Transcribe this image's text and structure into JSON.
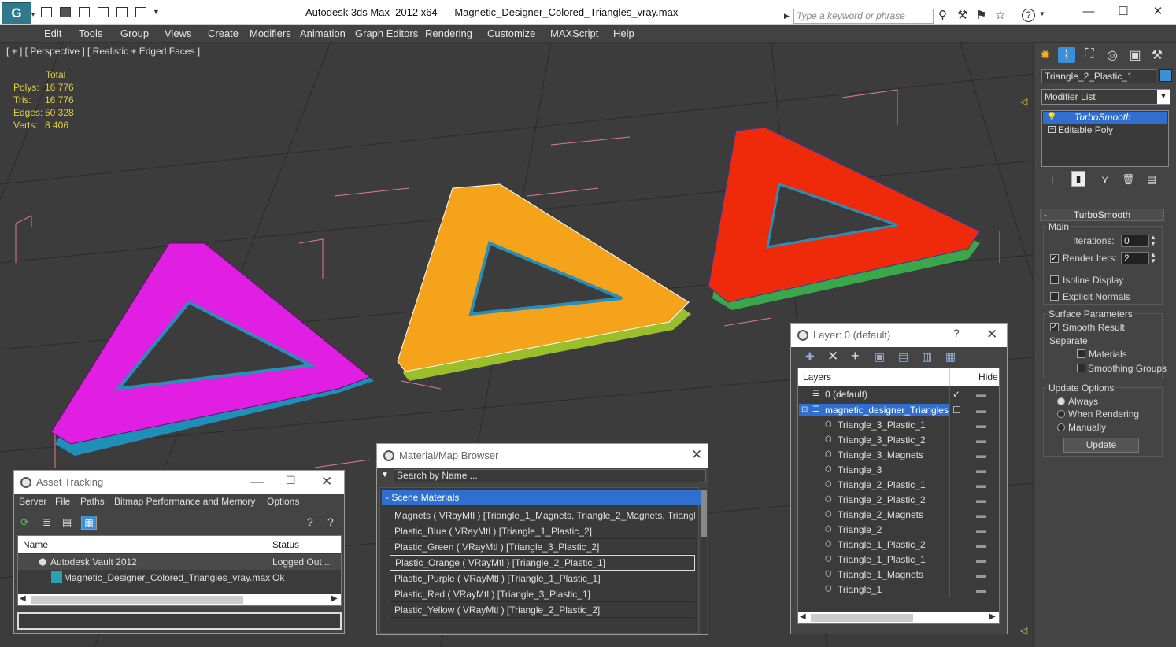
{
  "app": {
    "title": "Autodesk 3ds Max  2012 x64",
    "file": "Magnetic_Designer_Colored_Triangles_vray.max",
    "search_placeholder": "Type a keyword or phrase",
    "logo": "G"
  },
  "menu": [
    "Edit",
    "Tools",
    "Group",
    "Views",
    "Create",
    "Modifiers",
    "Animation",
    "Graph Editors",
    "Rendering",
    "Customize",
    "MAXScript",
    "Help"
  ],
  "viewport": {
    "label": "[ + ] [ Perspective ] [ Realistic + Edged Faces ]",
    "stats": {
      "header": "Total",
      "rows": [
        {
          "k": "Polys:",
          "v": "16 776"
        },
        {
          "k": "Tris:",
          "v": "16 776"
        },
        {
          "k": "Edges:",
          "v": "50 328"
        },
        {
          "k": "Verts:",
          "v": "8 406"
        }
      ]
    },
    "objects": [
      {
        "name": "purple",
        "color": "#e01fe3"
      },
      {
        "name": "orange",
        "color": "#f5a31b"
      },
      {
        "name": "red",
        "color": "#ee2a0a"
      }
    ]
  },
  "cmdpanel": {
    "object_name": "Triangle_2_Plastic_1",
    "object_color": "#3a8fd6",
    "modifier_list": "Modifier List",
    "stack": [
      {
        "label": "TurboSmooth",
        "selected": true
      },
      {
        "label": "Editable Poly",
        "selected": false
      }
    ],
    "rollout": "TurboSmooth",
    "main": "Main",
    "iterations_label": "Iterations:",
    "iterations": "0",
    "render_iters_label": "Render Iters:",
    "render_iters": "2",
    "isoline": "Isoline Display",
    "explicit": "Explicit Normals",
    "surface": "Surface Parameters",
    "smooth": "Smooth Result",
    "separate": "Separate",
    "materials": "Materials",
    "smoothing_groups": "Smoothing Groups",
    "update_options": "Update Options",
    "always": "Always",
    "when_rendering": "When Rendering",
    "manually": "Manually",
    "update": "Update"
  },
  "asset": {
    "title": "Asset Tracking",
    "menu": [
      "Server",
      "File",
      "Paths",
      "Bitmap Performance and Memory",
      "Options"
    ],
    "col_name": "Name",
    "col_status": "Status",
    "rows": [
      {
        "name": "Autodesk Vault 2012",
        "status": "Logged Out ..."
      },
      {
        "name": "Magnetic_Designer_Colored_Triangles_vray.max",
        "status": "Ok"
      }
    ]
  },
  "matbrowser": {
    "title": "Material/Map Browser",
    "search": "Search by Name ...",
    "group": "- Scene Materials",
    "items": [
      "Magnets  ( VRayMtl )  [Triangle_1_Magnets, Triangle_2_Magnets, Triangl...",
      "Plastic_Blue  ( VRayMtl )  [Triangle_1_Plastic_2]",
      "Plastic_Green  ( VRayMtl )  [Triangle_3_Plastic_2]",
      "Plastic_Orange  ( VRayMtl )  [Triangle_2_Plastic_1]",
      "Plastic_Purple  ( VRayMtl )  [Triangle_1_Plastic_1]",
      "Plastic_Red  ( VRayMtl )  [Triangle_3_Plastic_1]",
      "Plastic_Yellow  ( VRayMtl )  [Triangle_2_Plastic_2]"
    ]
  },
  "layers": {
    "title": "Layer: 0 (default)",
    "help": "?",
    "col_layers": "Layers",
    "col_hide": "Hide",
    "rows": [
      "0 (default)",
      "magnetic_designer_Triangles",
      "Triangle_3_Plastic_1",
      "Triangle_3_Plastic_2",
      "Triangle_3_Magnets",
      "Triangle_3",
      "Triangle_2_Plastic_1",
      "Triangle_2_Plastic_2",
      "Triangle_2_Magnets",
      "Triangle_2",
      "Triangle_1_Plastic_2",
      "Triangle_1_Plastic_1",
      "Triangle_1_Magnets",
      "Triangle_1"
    ]
  }
}
